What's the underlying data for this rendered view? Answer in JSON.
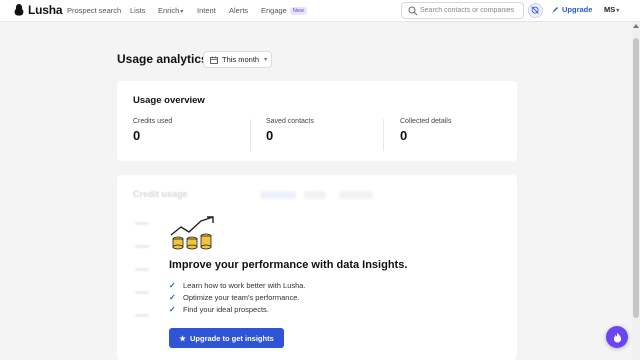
{
  "brand": {
    "name": "Lusha"
  },
  "nav": {
    "items": [
      {
        "label": "Prospect search"
      },
      {
        "label": "Lists"
      },
      {
        "label": "Enrich"
      },
      {
        "label": "Intent"
      },
      {
        "label": "Alerts"
      },
      {
        "label": "Engage"
      }
    ],
    "engage_badge": "New",
    "search_placeholder": "Search contacts or companies",
    "upgrade_label": "Upgrade",
    "user_initials": "MS"
  },
  "page": {
    "title": "Usage analytics",
    "period_label": "This month"
  },
  "overview": {
    "title": "Usage overview",
    "stats": [
      {
        "label": "Credits used",
        "value": "0"
      },
      {
        "label": "Saved contacts",
        "value": "0"
      },
      {
        "label": "Collected details",
        "value": "0"
      }
    ]
  },
  "credit_usage": {
    "title": "Credit usage",
    "promo": {
      "heading": "Improve your performance with data Insights.",
      "bullets": [
        "Learn how to work better with Lusha.",
        "Optimize your team's performance.",
        "Find your ideal prospects."
      ],
      "button_label": "Upgrade to get insights"
    }
  },
  "colors": {
    "accent": "#2d55d6",
    "fab": "#6b45f0",
    "coin": "#f2c53d"
  }
}
